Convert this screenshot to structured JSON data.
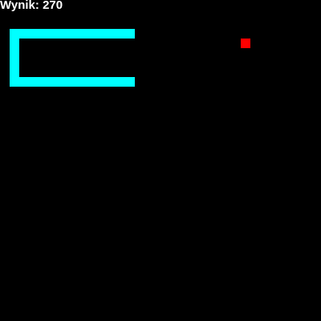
{
  "hud": {
    "score_label": "Wynik: 270",
    "score": 270
  },
  "grid": {
    "cols": 33,
    "rows": 33
  },
  "snake": {
    "color": "#00ffff",
    "cells": [
      [
        13,
        3
      ],
      [
        12,
        3
      ],
      [
        11,
        3
      ],
      [
        10,
        3
      ],
      [
        9,
        3
      ],
      [
        8,
        3
      ],
      [
        7,
        3
      ],
      [
        6,
        3
      ],
      [
        5,
        3
      ],
      [
        4,
        3
      ],
      [
        3,
        3
      ],
      [
        2,
        3
      ],
      [
        1,
        3
      ],
      [
        1,
        4
      ],
      [
        1,
        5
      ],
      [
        1,
        6
      ],
      [
        1,
        7
      ],
      [
        1,
        8
      ],
      [
        2,
        8
      ],
      [
        3,
        8
      ],
      [
        4,
        8
      ],
      [
        5,
        8
      ],
      [
        6,
        8
      ],
      [
        7,
        8
      ],
      [
        8,
        8
      ],
      [
        9,
        8
      ],
      [
        10,
        8
      ],
      [
        11,
        8
      ],
      [
        12,
        8
      ],
      [
        13,
        8
      ]
    ]
  },
  "food": {
    "color": "#ff0000",
    "cell": [
      25,
      4
    ]
  },
  "colors": {
    "background": "#000000",
    "text": "#ffffff"
  }
}
